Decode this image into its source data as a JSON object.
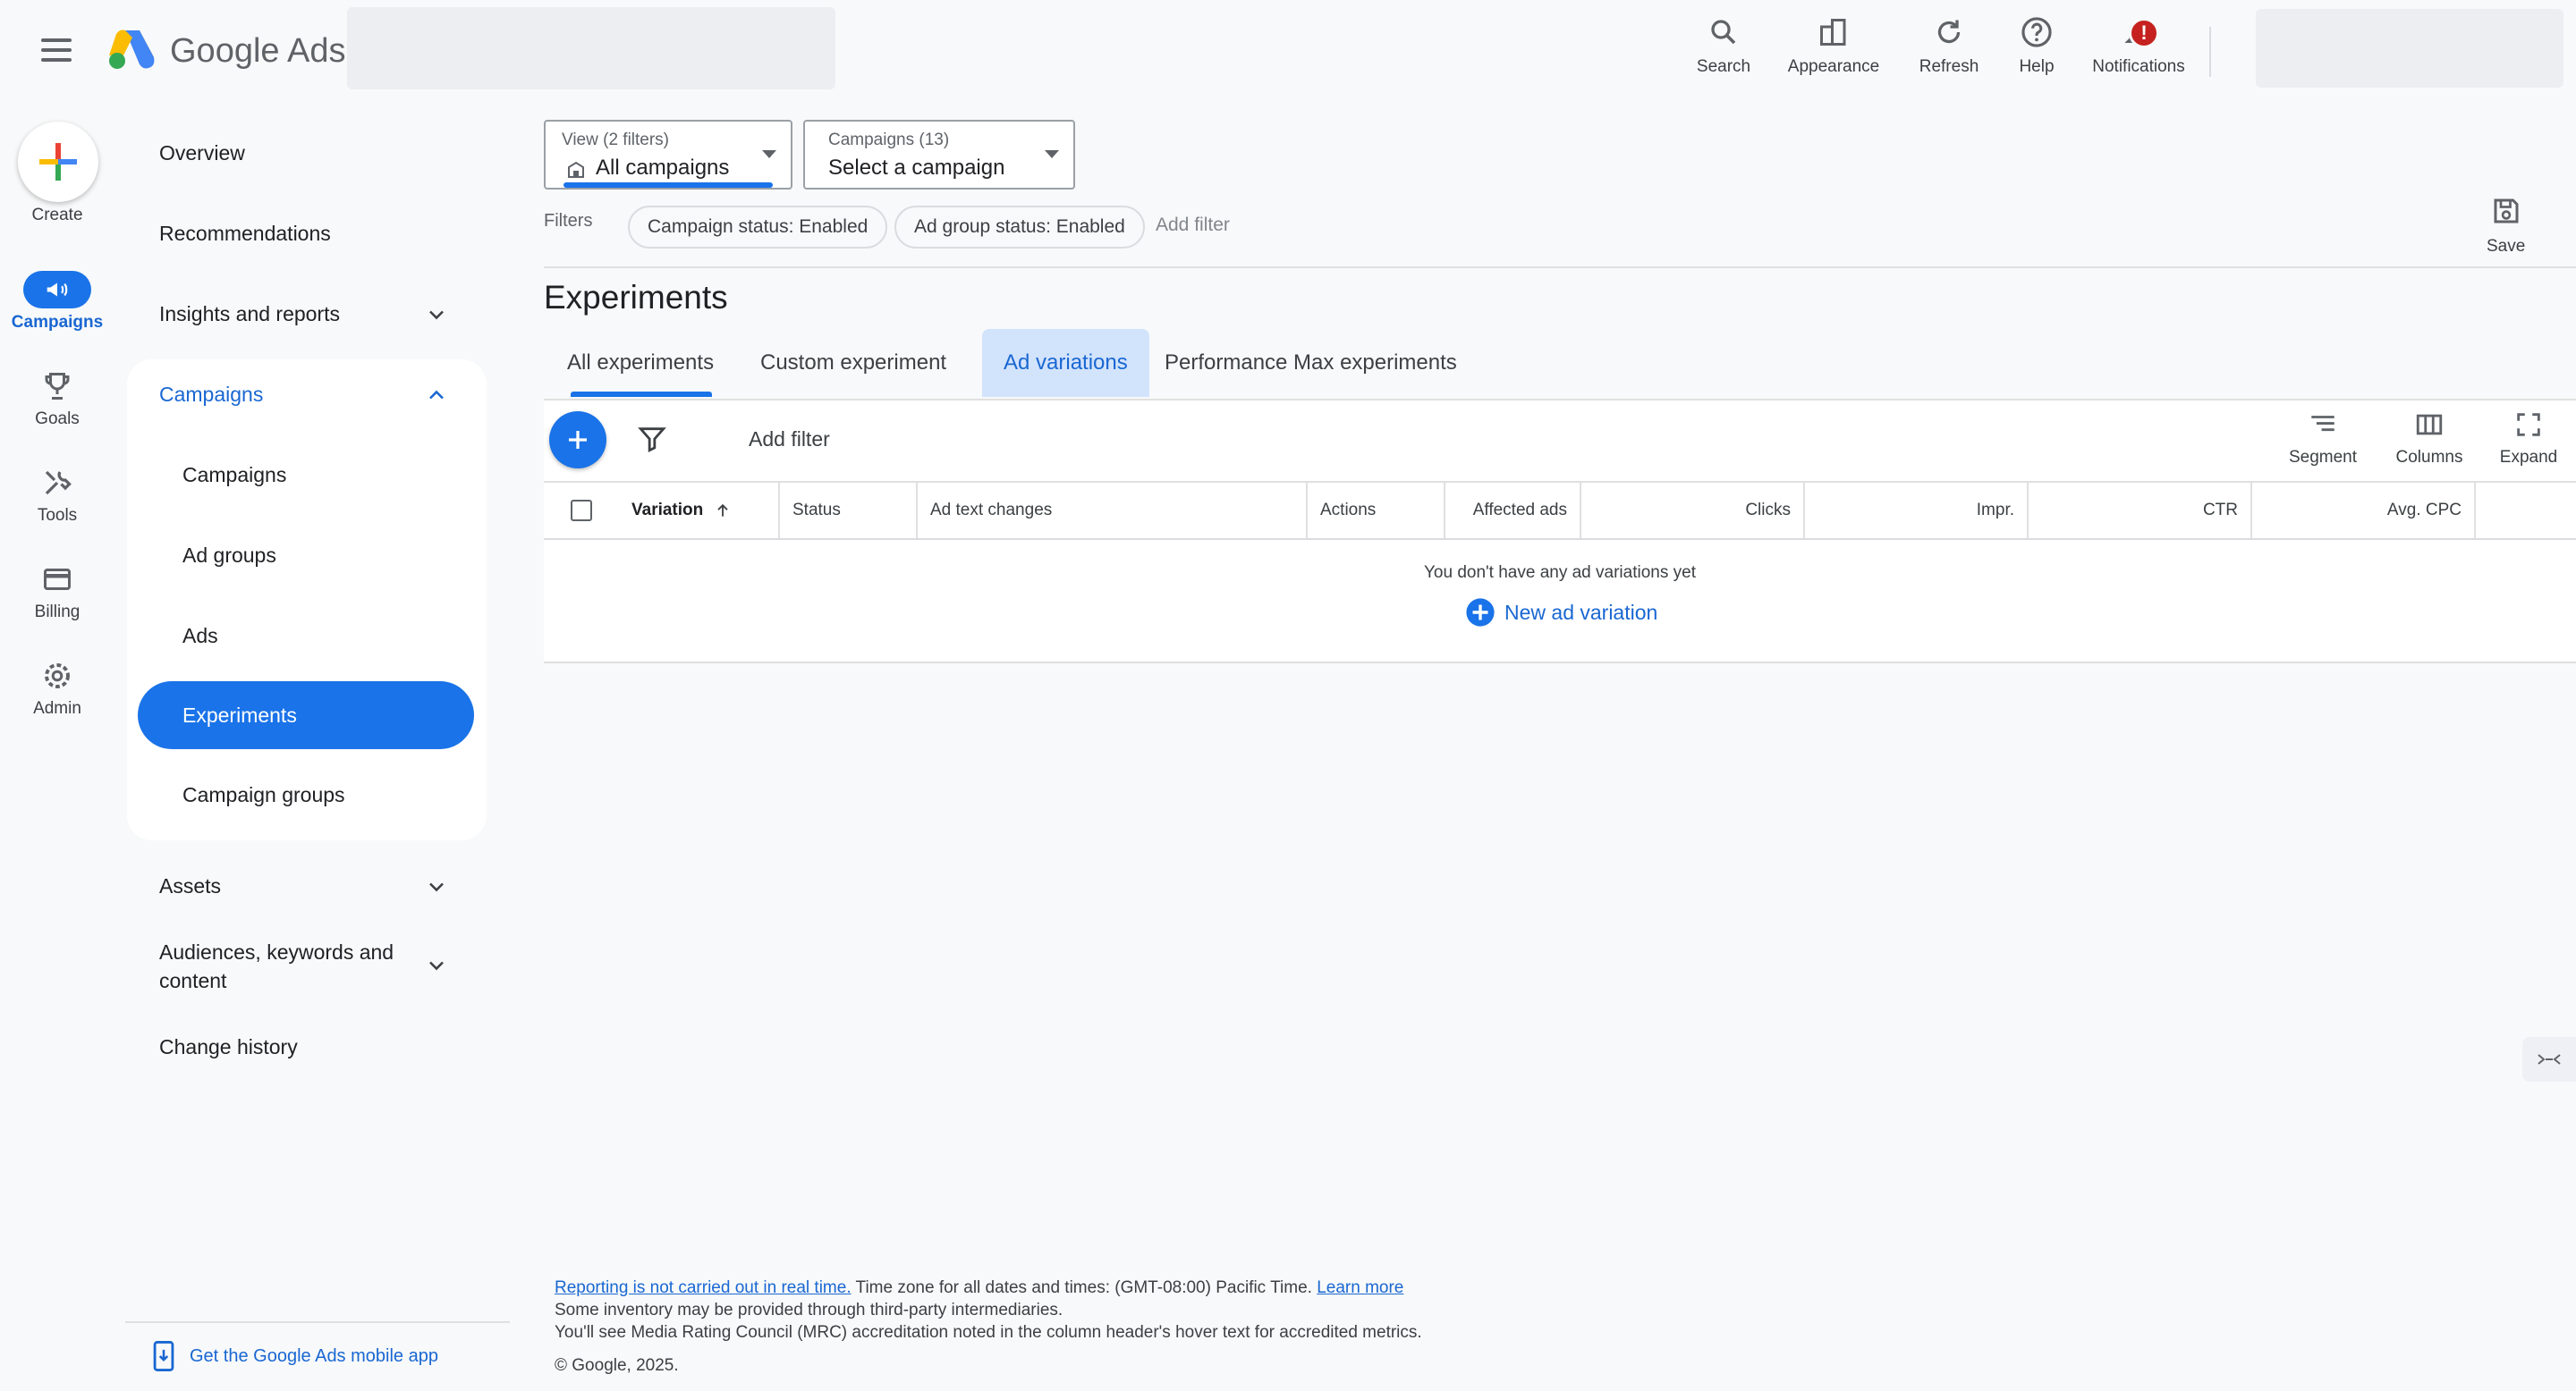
{
  "app": {
    "brand_google": "Google",
    "brand_ads": "Ads"
  },
  "topbar": {
    "actions": [
      {
        "label": "Search",
        "icon": "search-icon"
      },
      {
        "label": "Appearance",
        "icon": "appearance-icon"
      },
      {
        "label": "Refresh",
        "icon": "refresh-icon"
      },
      {
        "label": "Help",
        "icon": "help-icon"
      },
      {
        "label": "Notifications",
        "icon": "bell-icon",
        "badge": "!"
      }
    ]
  },
  "rail": {
    "create": "Create",
    "items": [
      {
        "label": "Campaigns",
        "icon": "megaphone-icon",
        "active": true
      },
      {
        "label": "Goals",
        "icon": "trophy-icon"
      },
      {
        "label": "Tools",
        "icon": "tools-icon"
      },
      {
        "label": "Billing",
        "icon": "card-icon"
      },
      {
        "label": "Admin",
        "icon": "gear-icon"
      }
    ]
  },
  "nav": {
    "overview": "Overview",
    "recommendations": "Recommendations",
    "insights": "Insights and reports",
    "campaigns_group": "Campaigns",
    "sub": [
      "Campaigns",
      "Ad groups",
      "Ads",
      "Experiments",
      "Campaign groups"
    ],
    "assets": "Assets",
    "audiences_line1": "Audiences, keywords and",
    "audiences_line2": "content",
    "change_history": "Change history",
    "mobile_app": "Get the Google Ads mobile app"
  },
  "selectors": {
    "view_small": "View (2 filters)",
    "view_value": "All campaigns",
    "campaign_small": "Campaigns (13)",
    "campaign_value": "Select a campaign"
  },
  "filters": {
    "label": "Filters",
    "chips": [
      "Campaign status: Enabled",
      "Ad group status: Enabled"
    ],
    "add": "Add filter",
    "save": "Save"
  },
  "page": {
    "title": "Experiments"
  },
  "tabs": [
    "All experiments",
    "Custom experiment",
    "Ad variations",
    "Performance Max experiments"
  ],
  "table": {
    "add_filter": "Add filter",
    "tools": [
      "Segment",
      "Columns",
      "Expand"
    ],
    "columns": [
      "Variation",
      "Status",
      "Ad text changes",
      "Actions",
      "Affected ads",
      "Clicks",
      "Impr.",
      "CTR",
      "Avg. CPC"
    ],
    "empty": "You don't have any ad variations yet",
    "new_variation": "New ad variation"
  },
  "footer": {
    "link1": "Reporting is not carried out in real time.",
    "text1": " Time zone for all dates and times: (GMT-08:00) Pacific Time. ",
    "link2": "Learn more",
    "line2": "Some inventory may be provided through third-party intermediaries.",
    "line3": "You'll see Media Rating Council (MRC) accreditation noted in the column header's hover text for accredited metrics.",
    "copyright": "© Google, 2025."
  },
  "colors": {
    "accent": "#1a73e8",
    "tab_highlight": "#d2e3fc",
    "badge": "#c5221f"
  }
}
